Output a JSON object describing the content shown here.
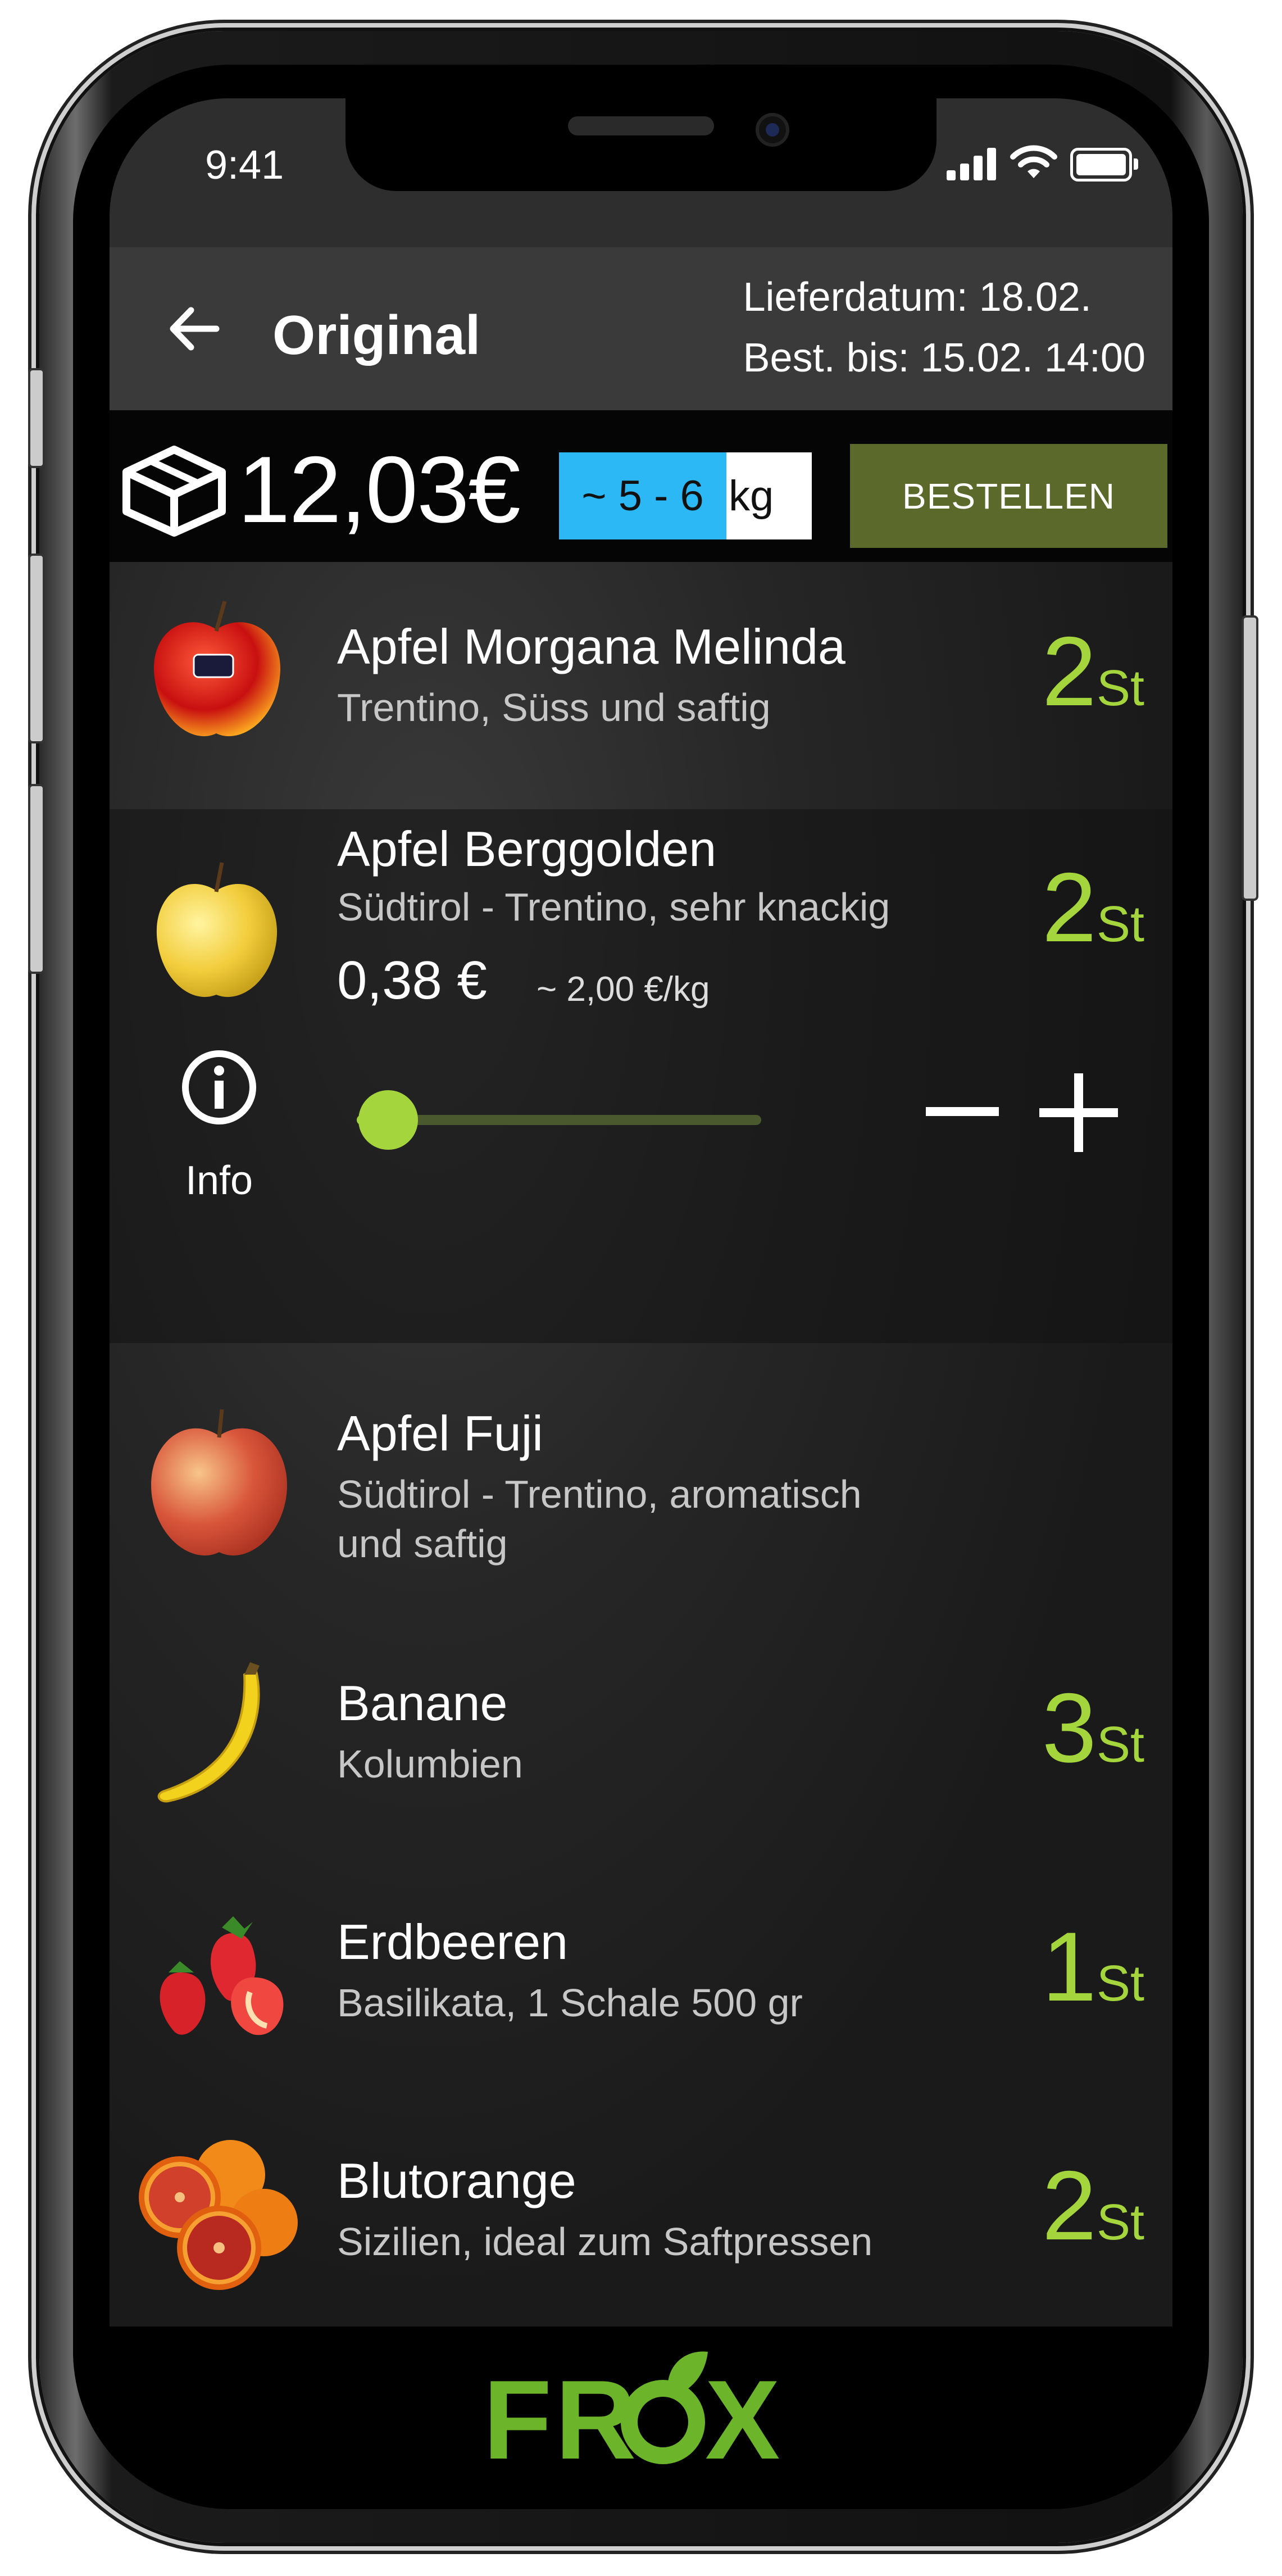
{
  "status": {
    "time": "9:41"
  },
  "header": {
    "title": "Original",
    "delivery_date": "Lieferdatum: 18.02.",
    "order_until": "Best. bis: 15.02. 14:00"
  },
  "summary": {
    "total_price": "12,03€",
    "weight_range": "~ 5 - 6",
    "weight_unit": "kg",
    "order_button": "BESTELLEN"
  },
  "products": [
    {
      "name": "Apfel Morgana Melinda",
      "origin": "Trentino, Süss und saftig",
      "qty": "2",
      "unit": "St",
      "icon": "red-apple-image"
    },
    {
      "name": "Apfel Berggolden",
      "origin": "Südtirol - Trentino, sehr knackig",
      "qty": "2",
      "unit": "St",
      "icon": "yellow-apple-image",
      "price": "0,38 €",
      "price_per_kg": "~ 2,00 €/kg",
      "info_label": "Info",
      "slider_level": 0.05
    },
    {
      "name": "Apfel Fuji",
      "origin": "Südtirol - Trentino, aromatisch und saftig",
      "qty": "",
      "unit": "",
      "icon": "fuji-apple-image"
    },
    {
      "name": "Banane",
      "origin": "Kolumbien",
      "qty": "3",
      "unit": "St",
      "icon": "banana-image"
    },
    {
      "name": "Erdbeeren",
      "origin": "Basilikata, 1 Schale 500 gr",
      "qty": "1",
      "unit": "St",
      "icon": "strawberries-image"
    },
    {
      "name": "Blutorange",
      "origin": "Sizilien, ideal zum Saftpressen",
      "qty": "2",
      "unit": "St",
      "icon": "blood-orange-image"
    }
  ],
  "footer": {
    "logo": "FROX"
  },
  "colors": {
    "accent_green": "#a5d53d",
    "button_green": "#5b6a2b",
    "weight_blue": "#2bb8f4"
  }
}
